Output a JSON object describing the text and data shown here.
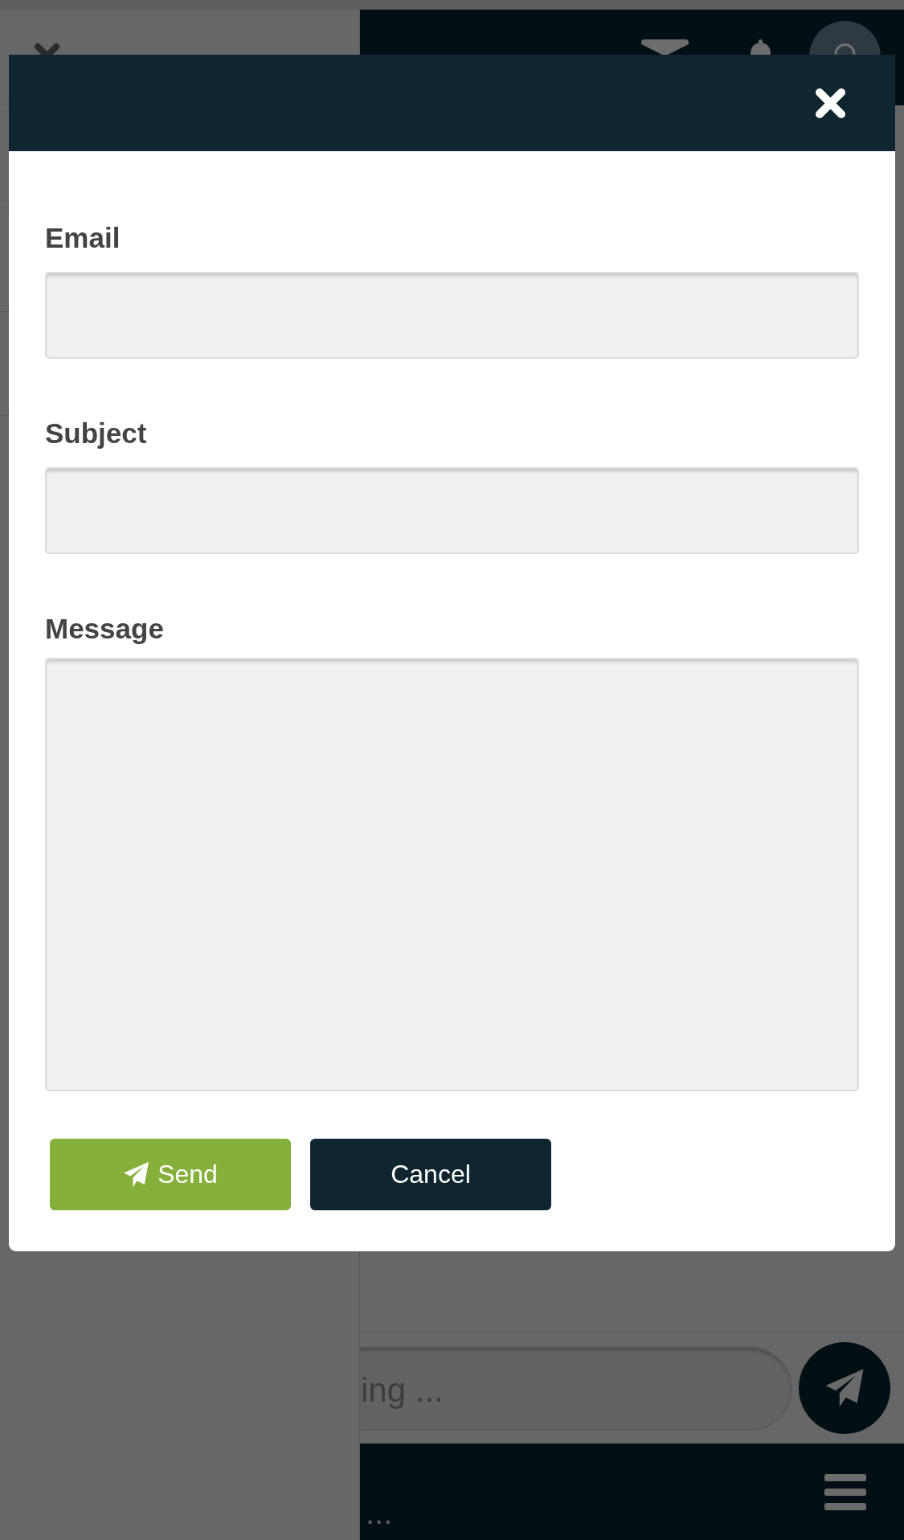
{
  "dialog": {
    "fields": [
      {
        "label": "Email",
        "kind": "input"
      },
      {
        "label": "Subject",
        "kind": "input"
      },
      {
        "label": "Message",
        "kind": "textarea"
      }
    ],
    "buttons": [
      {
        "label": "Send",
        "kind": "send"
      },
      {
        "label": "Cancel",
        "kind": "cancel"
      }
    ]
  },
  "background": {
    "message_input": {
      "placeholder": "ing ..."
    },
    "bottom_bar": {
      "text": "..."
    }
  }
}
